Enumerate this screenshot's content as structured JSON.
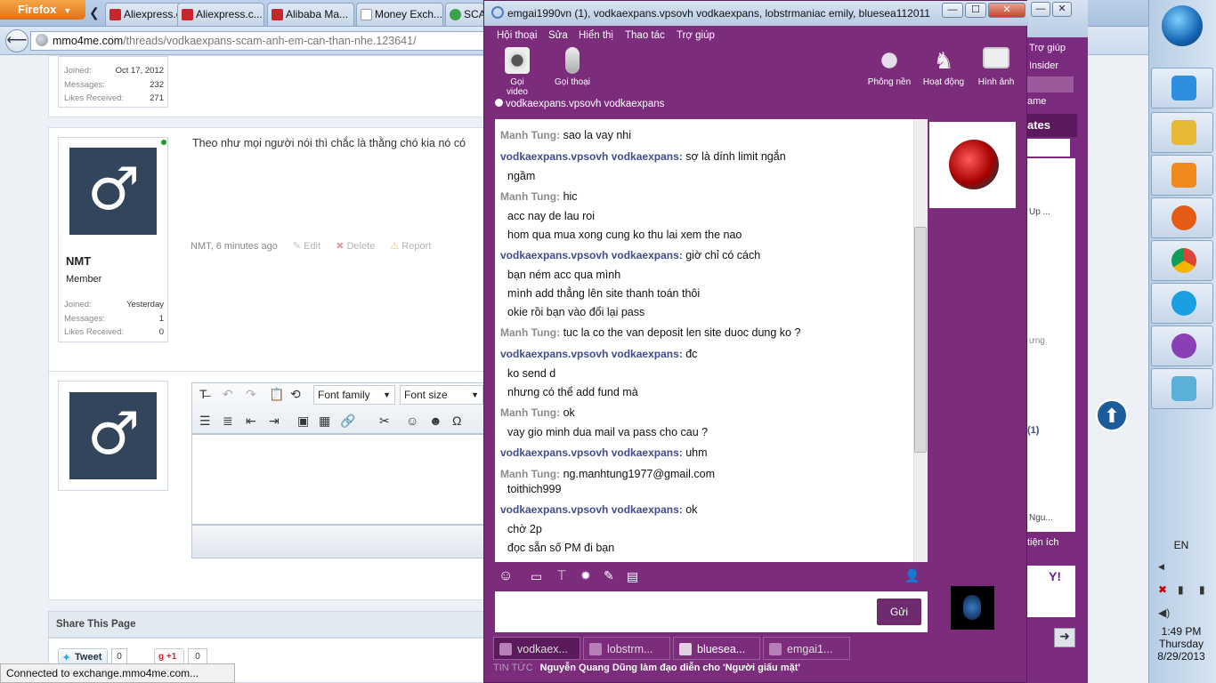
{
  "firefox": {
    "menu_label": "Firefox",
    "tabs": [
      {
        "label": "Aliexpress.c...",
        "color": "#c7262d"
      },
      {
        "label": "Aliexpress.c...",
        "color": "#c7262d"
      },
      {
        "label": "Alibaba Ma...",
        "color": "#c7262d"
      },
      {
        "label": "Money Exch...",
        "color": "#d5dbe3"
      },
      {
        "label": "SCA",
        "color": "#3ca04e"
      }
    ],
    "url_host": "mmo4me.com",
    "url_path": "/threads/vodkaexpans-scam-anh-em-can-than-nhe.123641/",
    "status": "Connected to exchange.mmo4me.com..."
  },
  "forum": {
    "prev_user": {
      "joined_label": "Joined:",
      "joined": "Oct 17, 2012",
      "messages_label": "Messages:",
      "messages": "232",
      "likes_label": "Likes Received:",
      "likes": "271"
    },
    "post": {
      "text": "Theo như mọi người nói thì chắc là thằng chó kia nó có",
      "meta": "NMT, 6 minutes ago",
      "edit": "Edit",
      "delete": "Delete",
      "report": "Report",
      "user": {
        "name": "NMT",
        "title": "Member",
        "joined_label": "Joined:",
        "joined": "Yesterday",
        "messages_label": "Messages:",
        "messages": "1",
        "likes_label": "Likes Received:",
        "likes": "0"
      }
    },
    "editor": {
      "font_family": "Font family",
      "font_size": "Font size"
    },
    "share": {
      "title": "Share This Page",
      "tweet": "Tweet",
      "tweet_count": "0",
      "gplus": "+1",
      "gplus_count": "0"
    }
  },
  "side_window": {
    "help": "Trợ giúp",
    "insider": "Insider",
    "game": "ame",
    "updates": "ates",
    "upline": "Up ...",
    "ung": "ưng",
    "count": "(1)",
    "ngu": "Ngu...",
    "tienich": "tiện ích"
  },
  "messenger": {
    "title": "emgai1990vn (1), vodkaexpans.vpsovh vodkaexpans, lobstrmaniac emily, bluesea112011",
    "menu": [
      "Hội thoại",
      "Sửa",
      "Hiển thị",
      "Thao tác",
      "Trợ giúp"
    ],
    "tools_left": [
      "Gọi video",
      "Gọi thoại"
    ],
    "tools_right": [
      "Phông nền",
      "Hoạt động",
      "Hình ảnh"
    ],
    "contact": "vodkaexpans.vpsovh vodkaexpans",
    "send": "Gửi",
    "messages": [
      {
        "who": "a",
        "name": "Manh Tung:",
        "text": "sao la vay nhi",
        "lines": []
      },
      {
        "who": "b",
        "name": "vodkaexpans.vpsovh vodkaexpans:",
        "text": "sợ là dính limit ngắn",
        "lines": [
          "ngầm"
        ]
      },
      {
        "who": "a",
        "name": "Manh Tung:",
        "text": "hic",
        "lines": [
          "acc nay de lau roi",
          "hom qua mua xong cung ko thu lai xem the nao"
        ]
      },
      {
        "who": "b",
        "name": "vodkaexpans.vpsovh vodkaexpans:",
        "text": "giờ chỉ có cách",
        "lines": [
          "bạn ném acc qua mình",
          "mình add thẳng lên site thanh toán thôi",
          "okie rồi bạn vào đổi lại pass"
        ]
      },
      {
        "who": "a",
        "name": "Manh Tung:",
        "text": "tuc la co the van deposit len site duoc dung ko ?",
        "lines": []
      },
      {
        "who": "b",
        "name": "vodkaexpans.vpsovh vodkaexpans:",
        "text": "đc",
        "lines": [
          "ko send d",
          "nhưng có thể add fund mà"
        ]
      },
      {
        "who": "a",
        "name": "Manh Tung:",
        "text": "ok",
        "lines": [
          "vay gio minh dua mail va pass cho cau ?"
        ]
      },
      {
        "who": "b",
        "name": "vodkaexpans.vpsovh vodkaexpans:",
        "text": "uhm",
        "lines": []
      },
      {
        "who": "a",
        "name": "Manh Tung:",
        "text": "ng.manhtung1977@gmail.com",
        "lines": [
          "toithich999"
        ]
      },
      {
        "who": "b",
        "name": "vodkaexpans.vpsovh vodkaexpans:",
        "text": "ok",
        "lines": [
          "chờ 2p",
          "đọc sẵn số PM đi bạn"
        ]
      }
    ],
    "tabs": [
      "vodkaex...",
      "lobstrm...",
      "bluesea...",
      "emgai1..."
    ],
    "news_label": "TIN TỨC",
    "news": "Nguyễn Quang Dũng làm đạo diễn cho 'Người giấu mặt'"
  },
  "taskbar": {
    "lang": "EN",
    "time": "1:49 PM",
    "day": "Thursday",
    "date": "8/29/2013",
    "apps": [
      {
        "name": "ie-icon",
        "color": "#2d8fe0"
      },
      {
        "name": "explorer-icon",
        "color": "#e6b935"
      },
      {
        "name": "media-player-icon",
        "color": "#f18a1d"
      },
      {
        "name": "firefox-icon",
        "color": "#e55b13"
      },
      {
        "name": "chrome-icon",
        "color": "#3aa757"
      },
      {
        "name": "skype-icon",
        "color": "#1aa0e2"
      },
      {
        "name": "yahoo-messenger-icon",
        "color": "#8a40b5"
      },
      {
        "name": "notepad-icon",
        "color": "#5ab0d8"
      }
    ]
  }
}
